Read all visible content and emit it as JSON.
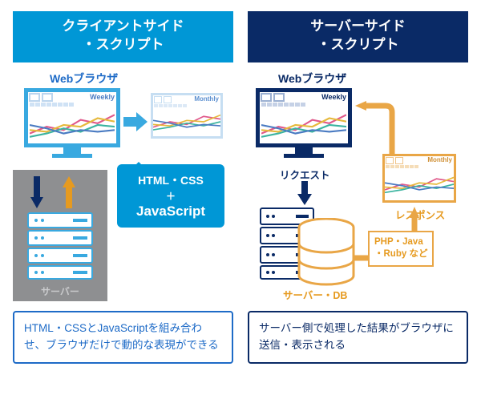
{
  "left": {
    "title_line1": "クライアントサイド",
    "title_line2": "・スクリプト",
    "browser_label": "Webブラウザ",
    "weekly": "Weekly",
    "monthly": "Monthly",
    "bubble_line1": "HTML・CSS",
    "bubble_plus": "＋",
    "bubble_js": "JavaScript",
    "server_label": "サーバー",
    "summary": "HTML・CSSとJavaScriptを組み合わせ、ブラウザだけで動的な表現ができる"
  },
  "right": {
    "title_line1": "サーバーサイド",
    "title_line2": "・スクリプト",
    "browser_label": "Webブラウザ",
    "weekly": "Weekly",
    "monthly": "Monthly",
    "request_label": "リクエスト",
    "response_label": "レスポンス",
    "server_db_label": "サーバー・DB",
    "lang_line1": "PHP・Java",
    "lang_line2": "・Ruby など",
    "summary": "サーバー側で処理した結果がブラウザに送信・表示される"
  },
  "colors": {
    "client_blue": "#0097d6",
    "navy": "#0a2a66",
    "orange": "#e69a1f",
    "grey": "#8e8f91"
  }
}
